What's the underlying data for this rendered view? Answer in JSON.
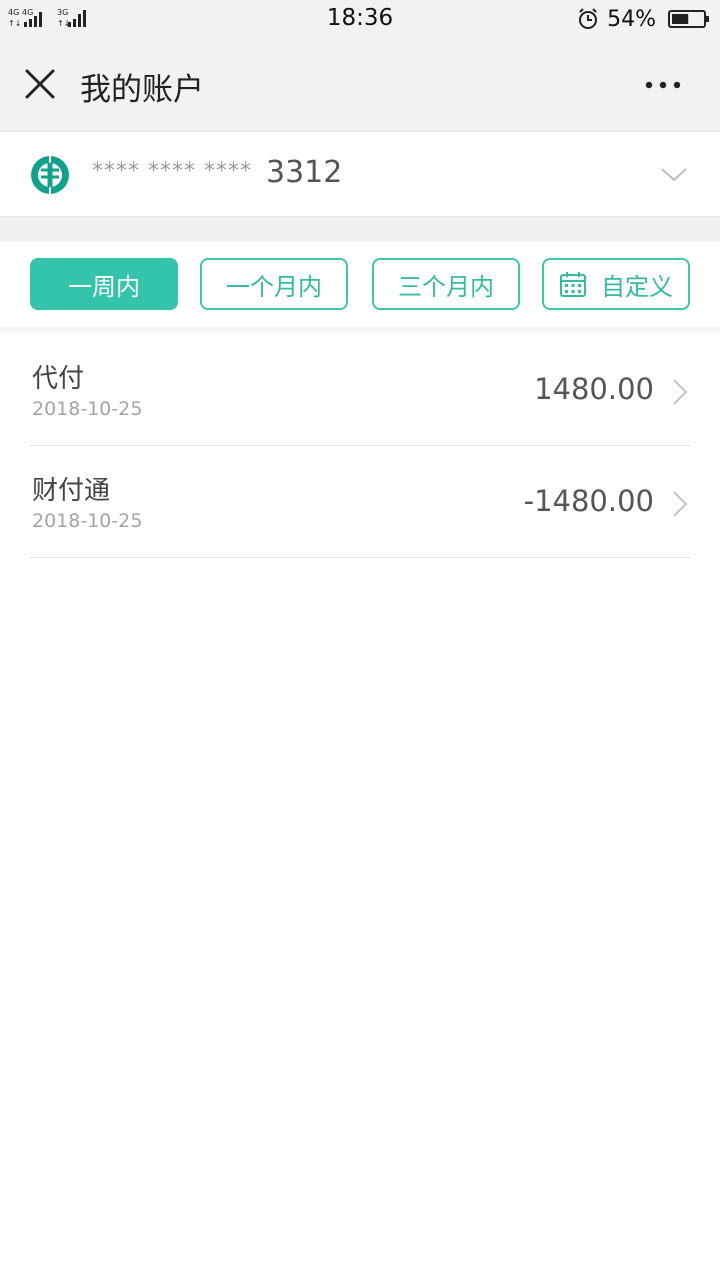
{
  "status_bar": {
    "network_left": "4G",
    "network_mid": "4G",
    "network_right": "3G",
    "time": "18:36",
    "battery_percent": "54%",
    "battery_level": 0.54
  },
  "nav": {
    "title": "我的账户"
  },
  "account": {
    "mask": "**** **** ****",
    "last_digits": "3312",
    "bank_color": "#12a18a"
  },
  "filters": [
    {
      "label": "一周内",
      "active": true
    },
    {
      "label": "一个月内",
      "active": false
    },
    {
      "label": "三个月内",
      "active": false
    },
    {
      "label": "自定义",
      "active": false,
      "icon": "calendar-icon"
    }
  ],
  "transactions": [
    {
      "title": "代付",
      "date": "2018-10-25",
      "amount": "1480.00"
    },
    {
      "title": "财付通",
      "date": "2018-10-25",
      "amount": "-1480.00"
    }
  ],
  "colors": {
    "accent": "#33c4ab",
    "nav_bg": "#f2f2f2"
  }
}
